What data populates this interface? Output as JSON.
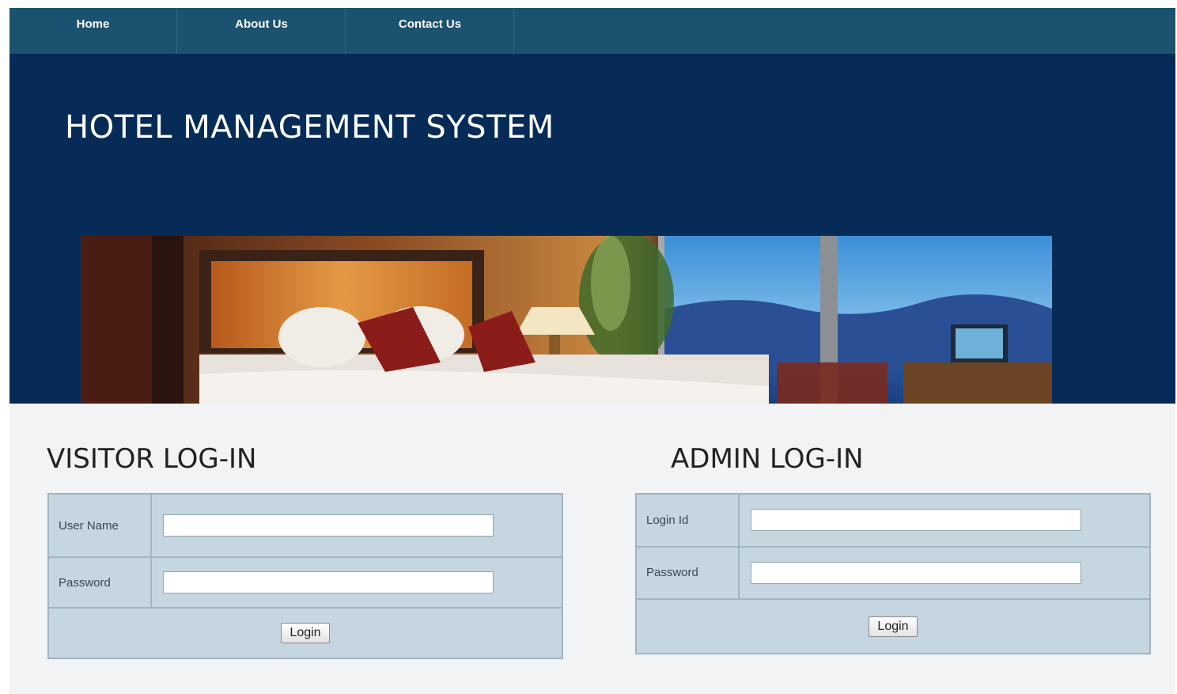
{
  "nav": {
    "items": [
      {
        "label": "Home"
      },
      {
        "label": "About Us"
      },
      {
        "label": "Contact Us"
      }
    ]
  },
  "header": {
    "title": "HOTEL MANAGEMENT SYSTEM"
  },
  "visitor_login": {
    "title": "VISITOR LOG-IN",
    "username_label": "User Name",
    "username_value": "",
    "password_label": "Password",
    "password_value": "",
    "button_label": "Login"
  },
  "admin_login": {
    "title": "ADMIN LOG-IN",
    "login_id_label": "Login Id",
    "login_id_value": "",
    "password_label": "Password",
    "password_value": "",
    "button_label": "Login"
  },
  "colors": {
    "nav_bg": "#1b5270",
    "header_bg": "#062b57",
    "form_bg": "#c5d6e0"
  }
}
